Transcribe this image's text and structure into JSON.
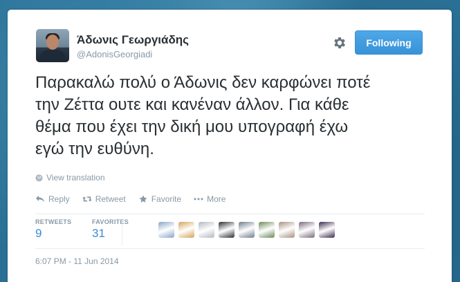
{
  "user": {
    "name": "Άδωνις Γεωργιάδης",
    "handle": "@AdonisGeorgiadi"
  },
  "follow_button_label": "Following",
  "tweet": {
    "lines": [
      "Παρακαλώ πολύ ο Άδωνις δεν καρφώνει ποτέ",
      "την Ζέττα ουτε και κανέναν άλλον. Για κάθε",
      "θέμα που έχει την δική μου υπογραφή έχω",
      "εγώ την ευθύνη."
    ]
  },
  "view_translation": "View translation",
  "actions": {
    "reply": "Reply",
    "retweet": "Retweet",
    "favorite": "Favorite",
    "more": "More"
  },
  "stats": {
    "retweets_label": "RETWEETS",
    "retweets_value": "9",
    "favorites_label": "FAVORITES",
    "favorites_value": "31"
  },
  "favoriter_avatars": [
    {
      "name": "avatar-1",
      "color": "#8aa4c8"
    },
    {
      "name": "avatar-2",
      "color": "#d7a35a"
    },
    {
      "name": "avatar-3",
      "color": "#b3b8c0"
    },
    {
      "name": "avatar-4",
      "color": "#2c2e33"
    },
    {
      "name": "avatar-5",
      "color": "#6e7d8c"
    },
    {
      "name": "avatar-6",
      "color": "#6b8a5a"
    },
    {
      "name": "avatar-7",
      "color": "#a99080"
    },
    {
      "name": "avatar-8",
      "color": "#7a6a7c"
    },
    {
      "name": "avatar-9",
      "color": "#3c2a4e"
    }
  ],
  "timestamp": "6:07 PM - 11 Jun 2014",
  "colors": {
    "accent": "#3893d7",
    "link": "#3a8ad2",
    "muted": "#8899a6",
    "text": "#292f33"
  }
}
